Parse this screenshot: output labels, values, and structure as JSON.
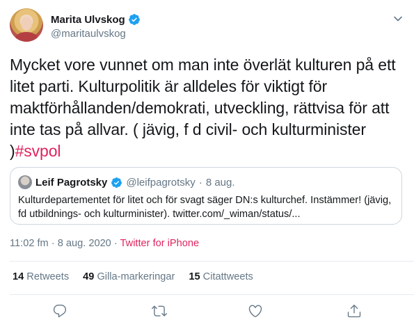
{
  "author": {
    "name": "Marita Ulvskog",
    "handle": "@maritaulvskog",
    "verified": true
  },
  "tweet": {
    "text": "Mycket vore vunnet om man inte överlät kulturen på ett litet parti. Kulturpolitik är alldeles för viktigt för maktförhållanden/demokrati, utveckling, rättvisa för att inte tas på allvar. ( jävig, f d civil- och kulturminister )",
    "hashtag": "#svpol"
  },
  "quoted": {
    "name": "Leif Pagrotsky",
    "handle": "@leifpagrotsky",
    "separator": "·",
    "date": "8 aug.",
    "text": "Kulturdepartementet för litet och för svagt säger DN:s kulturchef. Instämmer! (jävig, fd utbildnings- och kulturminister). twitter.com/_wiman/status/..."
  },
  "meta": {
    "time": "11:02 fm",
    "separator1": "·",
    "date": "8 aug. 2020",
    "separator2": "·",
    "source": "Twitter for iPhone"
  },
  "stats": {
    "retweets_count": "14",
    "retweets_label": "Retweets",
    "likes_count": "49",
    "likes_label": "Gilla-markeringar",
    "quotes_count": "15",
    "quotes_label": "Citattweets"
  },
  "icons": {
    "reply": "reply-icon",
    "retweet": "retweet-icon",
    "like": "heart-icon",
    "share": "share-icon",
    "more": "chevron-down-icon"
  },
  "colors": {
    "accent": "#1da1f2",
    "hashtag": "#e0245e",
    "secondary_text": "#657786"
  }
}
